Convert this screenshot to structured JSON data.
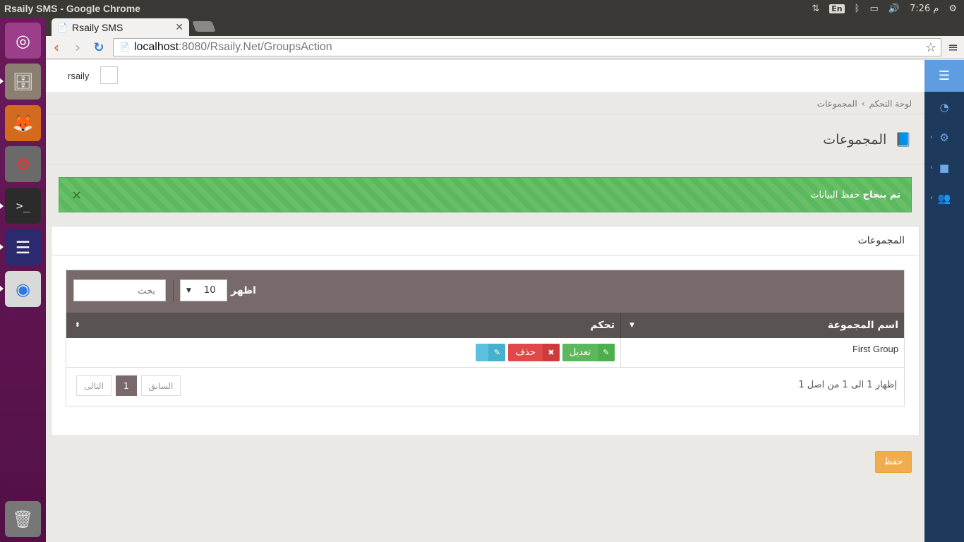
{
  "window": {
    "title": "Rsaily SMS - Google Chrome"
  },
  "tray": {
    "lang": "En",
    "time": "7:26 م"
  },
  "browser": {
    "tab_title": "Rsaily SMS",
    "url_host": "localhost",
    "url_path": ":8080/Rsaily.Net/GroupsAction"
  },
  "header": {
    "username": "rsaily"
  },
  "breadcrumb": {
    "home": "لوحة التحكم",
    "separator": "›",
    "current": "المجموعات"
  },
  "page": {
    "title": "المجموعات"
  },
  "alert": {
    "bold": "تم بنجاح",
    "text": " حفظ البيانات",
    "close": "×"
  },
  "panel": {
    "heading": "المجموعات"
  },
  "table": {
    "search_placeholder": "بحث",
    "length_value": "10",
    "length_label": "اظهر",
    "columns": [
      "اسم المجموعة",
      "تحكم"
    ],
    "rows": [
      {
        "name": "First Group"
      }
    ],
    "edit_label": "تعديل",
    "delete_label": "حذف",
    "info": "إظهار 1 الى 1 من اصل 1",
    "prev": "السابق",
    "page": "1",
    "next": "التالى"
  },
  "actions": {
    "save": "حفظ"
  }
}
